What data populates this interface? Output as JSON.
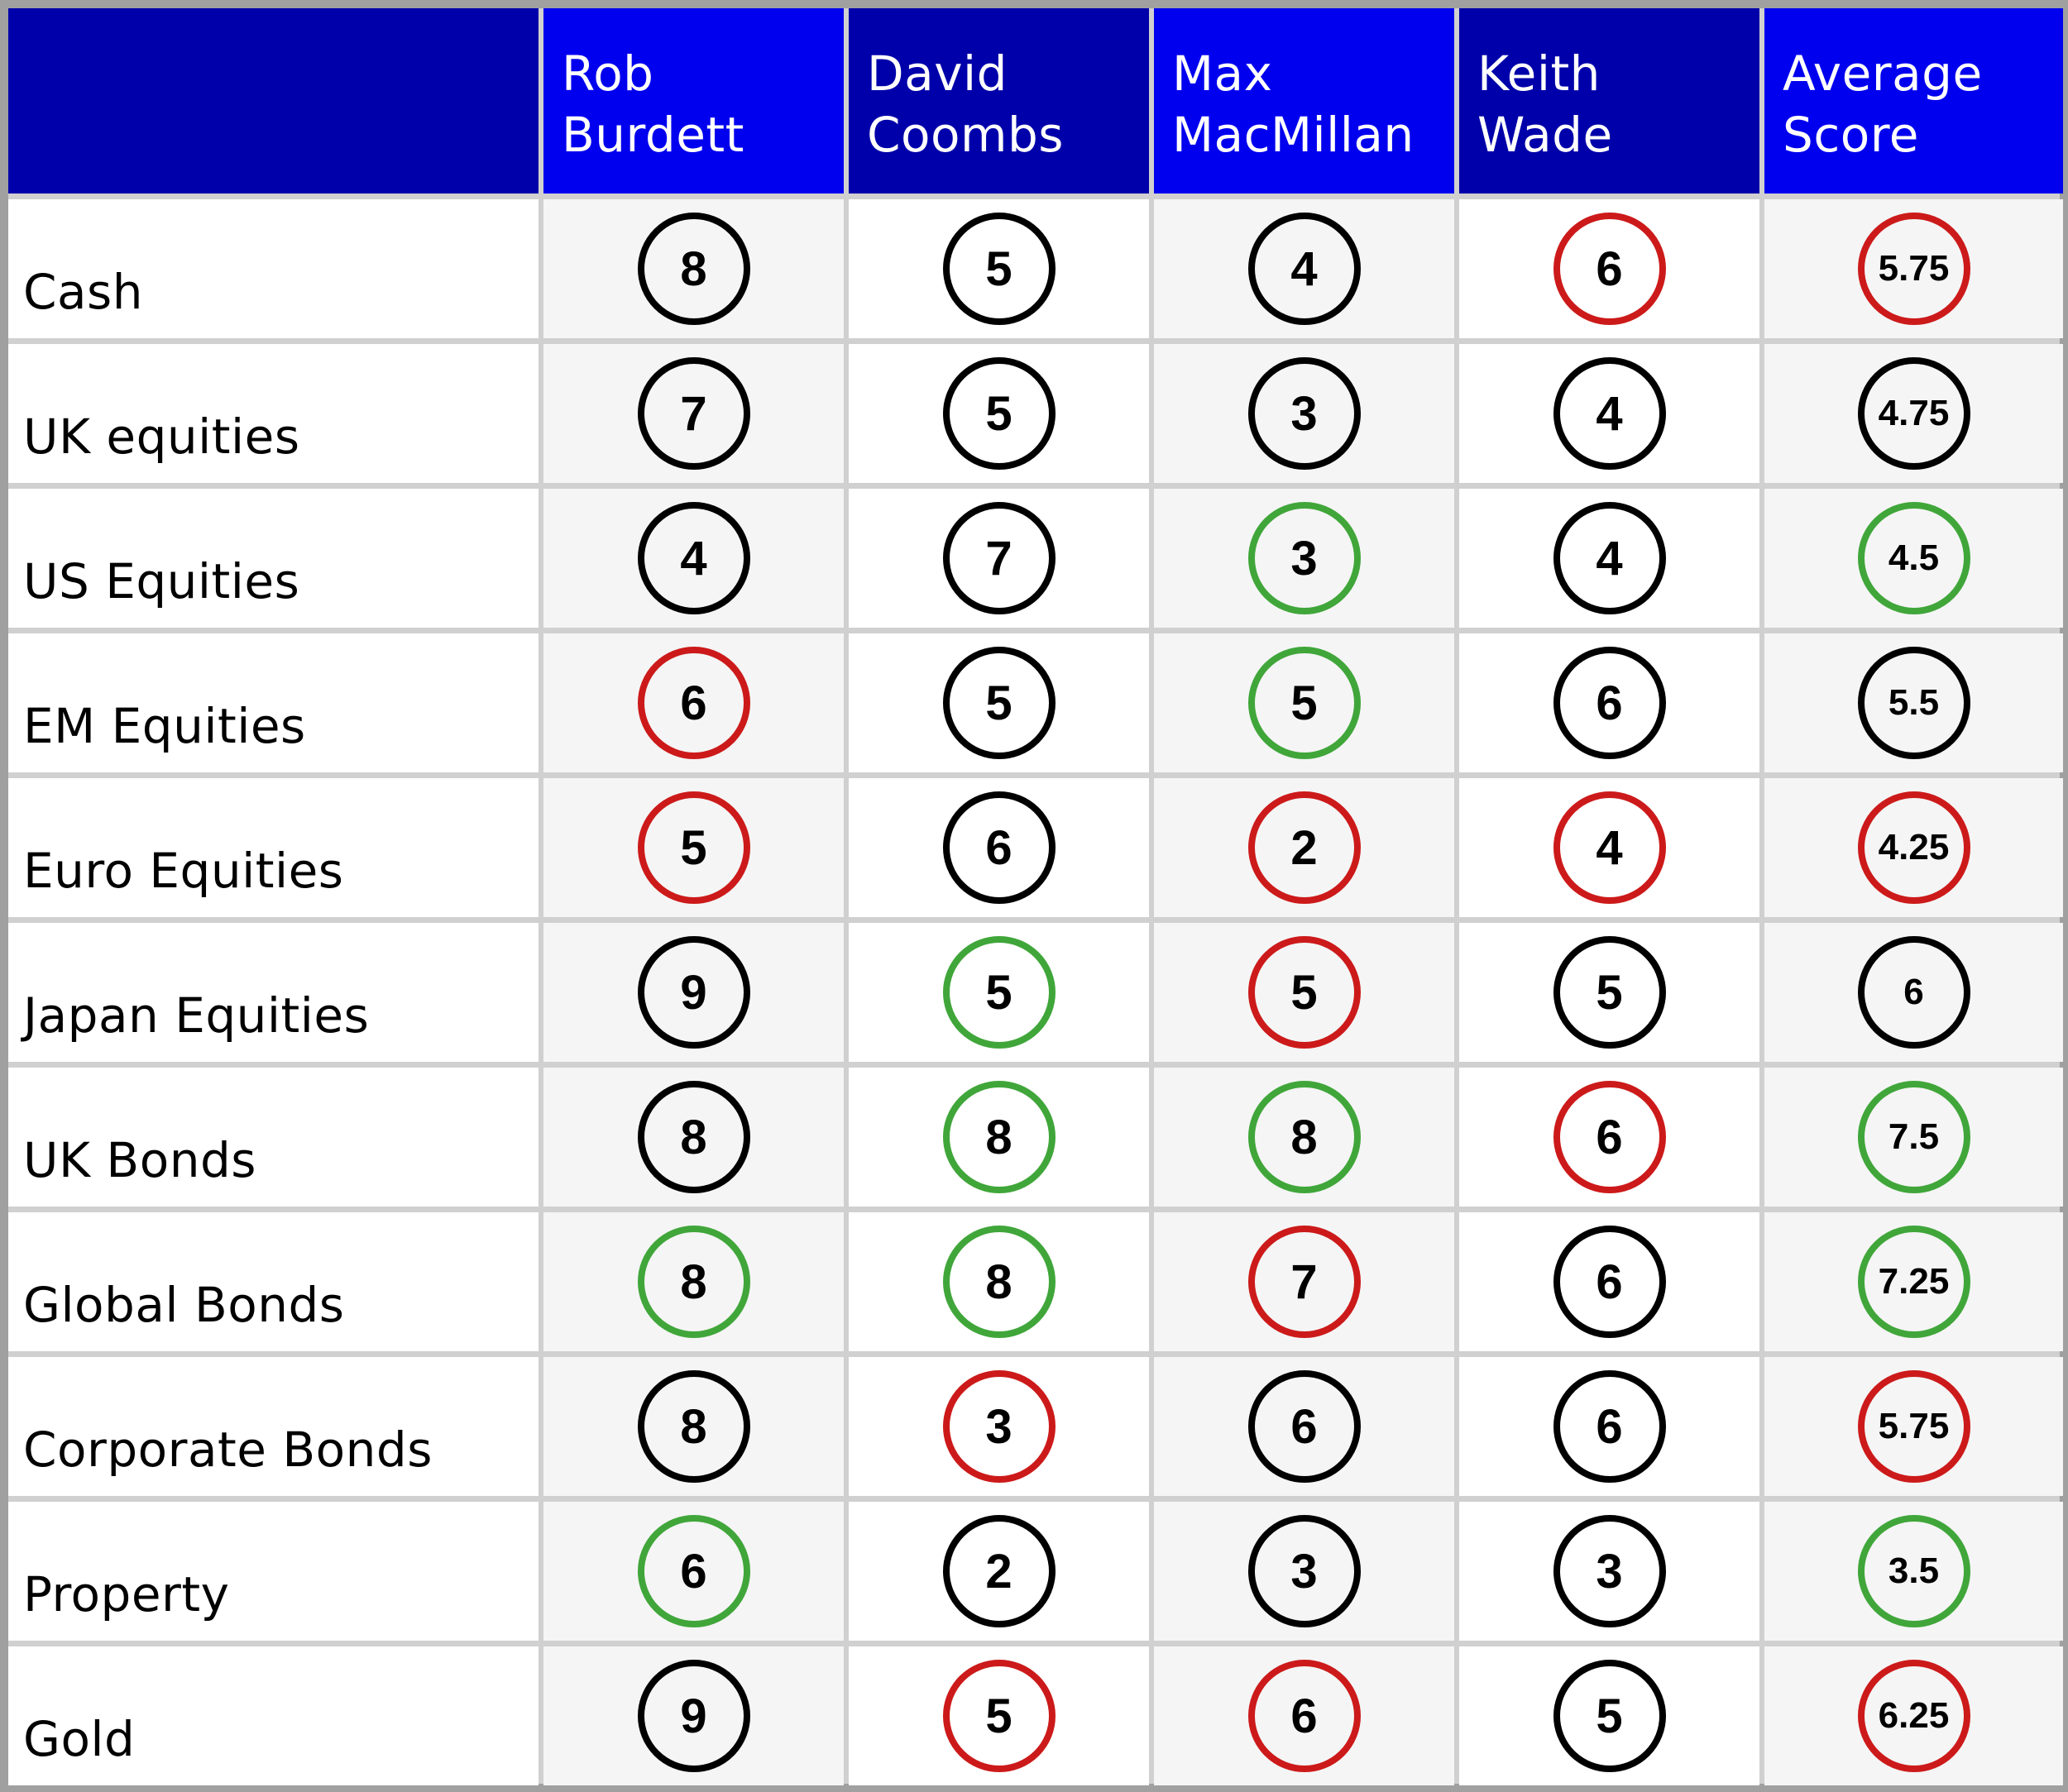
{
  "table": {
    "columns": [
      {
        "label": ""
      },
      {
        "label": "Rob\nBurdett"
      },
      {
        "label": "David\nCoombs"
      },
      {
        "label": "Max\nMacMillan"
      },
      {
        "label": "Keith\nWade"
      },
      {
        "label": "Average\nScore"
      }
    ],
    "status_colors": {
      "red": "#cc1a1a",
      "green": "#40a63a",
      "black": "#000000"
    },
    "header_colors": {
      "dark": "#0000aa",
      "bright": "#0000ee"
    },
    "rows": [
      {
        "asset": "Cash",
        "scores": [
          {
            "value": "8",
            "color": "black"
          },
          {
            "value": "5",
            "color": "black"
          },
          {
            "value": "4",
            "color": "black"
          },
          {
            "value": "6",
            "color": "red"
          },
          {
            "value": "5.75",
            "color": "red"
          }
        ]
      },
      {
        "asset": "UK equities",
        "scores": [
          {
            "value": "7",
            "color": "black"
          },
          {
            "value": "5",
            "color": "black"
          },
          {
            "value": "3",
            "color": "black"
          },
          {
            "value": "4",
            "color": "black"
          },
          {
            "value": "4.75",
            "color": "black"
          }
        ]
      },
      {
        "asset": "US Equities",
        "scores": [
          {
            "value": "4",
            "color": "black"
          },
          {
            "value": "7",
            "color": "black"
          },
          {
            "value": "3",
            "color": "green"
          },
          {
            "value": "4",
            "color": "black"
          },
          {
            "value": "4.5",
            "color": "green"
          }
        ]
      },
      {
        "asset": "EM Equities",
        "scores": [
          {
            "value": "6",
            "color": "red"
          },
          {
            "value": "5",
            "color": "black"
          },
          {
            "value": "5",
            "color": "green"
          },
          {
            "value": "6",
            "color": "black"
          },
          {
            "value": "5.5",
            "color": "black"
          }
        ]
      },
      {
        "asset": "Euro Equities",
        "scores": [
          {
            "value": "5",
            "color": "red"
          },
          {
            "value": "6",
            "color": "black"
          },
          {
            "value": "2",
            "color": "red"
          },
          {
            "value": "4",
            "color": "red"
          },
          {
            "value": "4.25",
            "color": "red"
          }
        ]
      },
      {
        "asset": "Japan Equities",
        "scores": [
          {
            "value": "9",
            "color": "black"
          },
          {
            "value": "5",
            "color": "green"
          },
          {
            "value": "5",
            "color": "red"
          },
          {
            "value": "5",
            "color": "black"
          },
          {
            "value": "6",
            "color": "black"
          }
        ]
      },
      {
        "asset": "UK Bonds",
        "scores": [
          {
            "value": "8",
            "color": "black"
          },
          {
            "value": "8",
            "color": "green"
          },
          {
            "value": "8",
            "color": "green"
          },
          {
            "value": "6",
            "color": "red"
          },
          {
            "value": "7.5",
            "color": "green"
          }
        ]
      },
      {
        "asset": "Global Bonds",
        "scores": [
          {
            "value": "8",
            "color": "green"
          },
          {
            "value": "8",
            "color": "green"
          },
          {
            "value": "7",
            "color": "red"
          },
          {
            "value": "6",
            "color": "black"
          },
          {
            "value": "7.25",
            "color": "green"
          }
        ]
      },
      {
        "asset": "Corporate Bonds",
        "scores": [
          {
            "value": "8",
            "color": "black"
          },
          {
            "value": "3",
            "color": "red"
          },
          {
            "value": "6",
            "color": "black"
          },
          {
            "value": "6",
            "color": "black"
          },
          {
            "value": "5.75",
            "color": "red"
          }
        ]
      },
      {
        "asset": "Property",
        "scores": [
          {
            "value": "6",
            "color": "green"
          },
          {
            "value": "2",
            "color": "black"
          },
          {
            "value": "3",
            "color": "black"
          },
          {
            "value": "3",
            "color": "black"
          },
          {
            "value": "3.5",
            "color": "green"
          }
        ]
      },
      {
        "asset": "Gold",
        "scores": [
          {
            "value": "9",
            "color": "black"
          },
          {
            "value": "5",
            "color": "red"
          },
          {
            "value": "6",
            "color": "red"
          },
          {
            "value": "5",
            "color": "black"
          },
          {
            "value": "6.25",
            "color": "red"
          }
        ]
      }
    ]
  }
}
